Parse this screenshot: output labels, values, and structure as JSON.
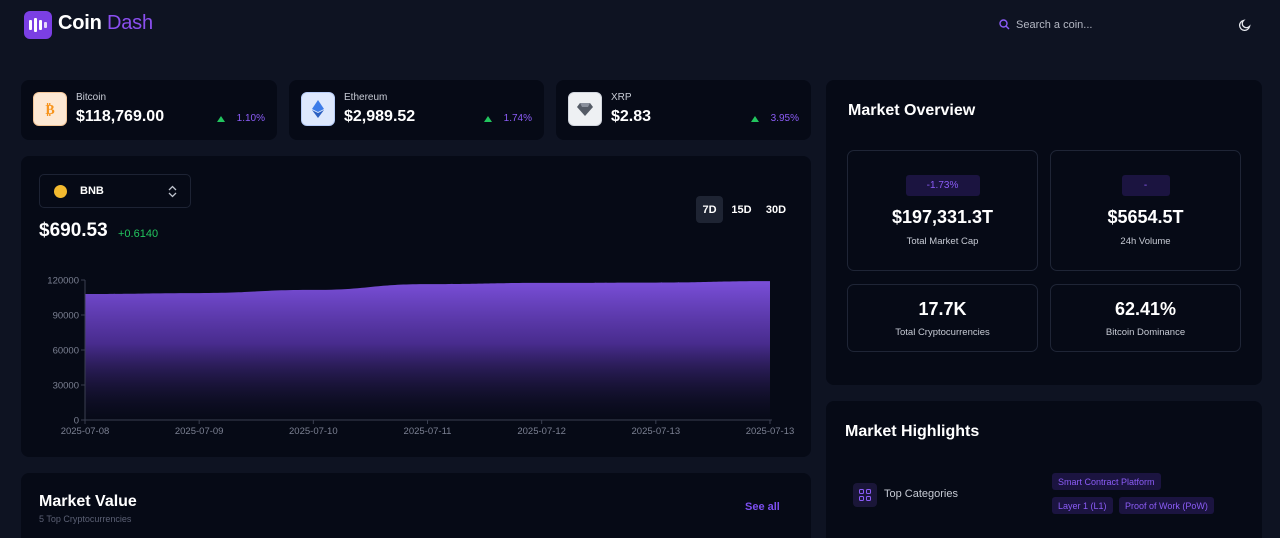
{
  "header": {
    "brand_part1": "Coin",
    "brand_part2": "Dash",
    "search_placeholder": "Search a coin...",
    "theme_icon": "moon-icon"
  },
  "ticker": [
    {
      "name": "Bitcoin",
      "price": "$118,769.00",
      "change": "1.10%",
      "icon": "bitcoin-icon",
      "icon_bg": "#fde8d3",
      "icon_color": "#f7931a"
    },
    {
      "name": "Ethereum",
      "price": "$2,989.52",
      "change": "1.74%",
      "icon": "ethereum-icon",
      "icon_bg": "#dde8fd",
      "icon_color": "#3c7be8"
    },
    {
      "name": "XRP",
      "price": "$2.83",
      "change": "3.95%",
      "icon": "xrp-icon",
      "icon_bg": "#eef0f3",
      "icon_color": "#555b66"
    }
  ],
  "price_chart": {
    "selected_coin": "BNB",
    "price": "$690.53",
    "change": "+0.6140",
    "ranges": [
      "7D",
      "15D",
      "30D"
    ],
    "active_range": "7D"
  },
  "chart_data": {
    "type": "area",
    "x": [
      "2025-07-08",
      "2025-07-09",
      "2025-07-10",
      "2025-07-11",
      "2025-07-12",
      "2025-07-13",
      "2025-07-13"
    ],
    "y": [
      108000,
      108800,
      111500,
      116500,
      117500,
      117800,
      119000
    ],
    "ylim": [
      0,
      120000
    ],
    "yticks": [
      0,
      30000,
      60000,
      90000,
      120000
    ],
    "area_color": "#7a4fd9",
    "grid": false
  },
  "market_overview": {
    "title": "Market Overview",
    "stats": [
      {
        "pill": "-1.73%",
        "value": "$197,331.3T",
        "label": "Total Market Cap"
      },
      {
        "pill": "-",
        "value": "$5654.5T",
        "label": "24h Volume"
      },
      {
        "value": "17.7K",
        "label": "Total Cryptocurrencies"
      },
      {
        "value": "62.41%",
        "label": "Bitcoin Dominance"
      }
    ]
  },
  "market_highlights": {
    "title": "Market Highlights",
    "category_label": "Top Categories",
    "tags": [
      "Smart Contract Platform",
      "Layer 1 (L1)",
      "Proof of Work (PoW)"
    ]
  },
  "market_value": {
    "title": "Market Value",
    "subtitle": "5 Top Cryptocurrencies",
    "link": "See all"
  },
  "colors": {
    "accent": "#7b3fe4",
    "positive": "#22c55e",
    "background": "#0e1322",
    "card": "#060a16"
  }
}
